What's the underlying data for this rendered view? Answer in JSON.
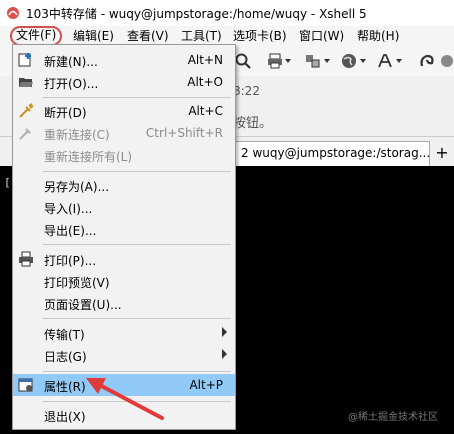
{
  "window": {
    "title": "103中转存储 - wuqy@jumpstorage:/home/wuqy - Xshell 5"
  },
  "menubar": {
    "items": [
      {
        "label": "文件(F)"
      },
      {
        "label": "编辑(E)"
      },
      {
        "label": "查看(V)"
      },
      {
        "label": "工具(T)"
      },
      {
        "label": "选项卡(B)"
      },
      {
        "label": "窗口(W)"
      },
      {
        "label": "帮助(H)"
      }
    ]
  },
  "toolbar": {
    "time_partial": "8:22"
  },
  "hint": {
    "text_partial": "按钮。"
  },
  "tabs": {
    "tab2_label": "2 wuqy@jumpstorage:/storag...",
    "add_label": "+"
  },
  "terminal": {
    "bracket": "["
  },
  "dropdown": {
    "items": [
      {
        "label": "新建(N)...",
        "shortcut": "Alt+N"
      },
      {
        "label": "打开(O)...",
        "shortcut": "Alt+O"
      },
      {
        "label": "断开(D)",
        "shortcut": "Alt+C"
      },
      {
        "label": "重新连接(C)",
        "shortcut": "Ctrl+Shift+R"
      },
      {
        "label": "重新连接所有(L)",
        "shortcut": ""
      },
      {
        "label": "另存为(A)...",
        "shortcut": ""
      },
      {
        "label": "导入(I)...",
        "shortcut": ""
      },
      {
        "label": "导出(E)...",
        "shortcut": ""
      },
      {
        "label": "打印(P)...",
        "shortcut": ""
      },
      {
        "label": "打印预览(V)",
        "shortcut": ""
      },
      {
        "label": "页面设置(U)...",
        "shortcut": ""
      },
      {
        "label": "传输(T)",
        "shortcut": ""
      },
      {
        "label": "日志(G)",
        "shortcut": ""
      },
      {
        "label": "属性(R)",
        "shortcut": "Alt+P"
      },
      {
        "label": "退出(X)",
        "shortcut": ""
      }
    ]
  },
  "watermark": "@稀土掘金技术社区",
  "colors": {
    "selected_bg": "#91c9f7",
    "annotation_red": "#e03a3a",
    "terminal_bg": "#000000"
  }
}
